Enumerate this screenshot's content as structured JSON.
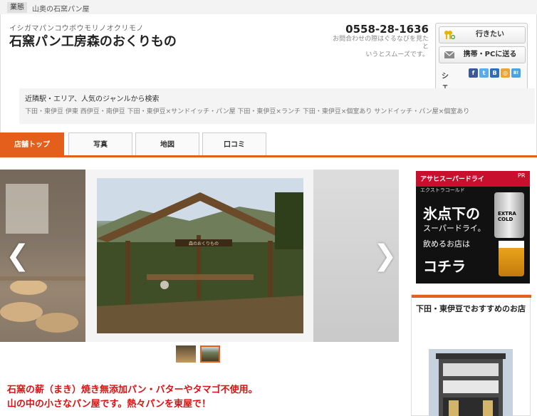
{
  "tagbar": {
    "tag": "業態",
    "text": "山奥の石窯パン屋"
  },
  "shop": {
    "kana": "イシガマパンコウボウモリノオクリモノ",
    "name": "石窯パン工房森のおくりもの",
    "phone": "0558-28-1636",
    "phone_note": "お問合わせの際はぐるなびを見たと\nいうとスムーズです。"
  },
  "actions": {
    "go_label": "行きたい",
    "send_label": "携帯・PCに送る",
    "share_label": "シェア",
    "sns": [
      {
        "icon": "facebook-icon",
        "glyph": "f",
        "color": "#3b5998"
      },
      {
        "icon": "twitter-icon",
        "glyph": "t",
        "color": "#55acee"
      },
      {
        "icon": "hatena-bookmark-icon",
        "glyph": "B",
        "color": "#2c6ebd"
      },
      {
        "icon": "bookmark-icon",
        "glyph": "◎",
        "color": "#e8a53c"
      },
      {
        "icon": "bookmark-b-icon",
        "glyph": "B!",
        "color": "#4aa3df"
      }
    ]
  },
  "search": {
    "title": "近隣駅・エリア、人気のジャンルから検索",
    "links": "下田・東伊豆 伊東 西伊豆・南伊豆 下田・東伊豆×サンドイッチ・パン屋 下田・東伊豆×ランチ 下田・東伊豆×個室あり サンドイッチ・パン屋×個室あり"
  },
  "tabs": [
    {
      "label": "店舗トップ",
      "active": true
    },
    {
      "label": "写真",
      "active": false
    },
    {
      "label": "地図",
      "active": false
    },
    {
      "label": "口コミ",
      "active": false
    }
  ],
  "gallery": {
    "prev": "❮",
    "next": "❯",
    "photo_sign": "森のおくりもの"
  },
  "description": {
    "line1": "石窯の薪（まき）焼き無添加パン・バターやタマゴ不使用。",
    "line2": "山の中の小さなパン屋です。熱々パンを東屋で！"
  },
  "ad": {
    "brand": "アサヒスーパードライ",
    "sub": "エクストラコールド",
    "pr": "PR",
    "main1": "氷点下の",
    "main2": "スーパードライ。",
    "main3": "飲めるお店は",
    "main4": "コチラ",
    "can_text": "EXTRA\nCOLD"
  },
  "reco": {
    "title": "下田・東伊豆でおすすめのお店"
  },
  "colors": {
    "accent": "#e35f1b",
    "desc_red": "#dd1111"
  }
}
